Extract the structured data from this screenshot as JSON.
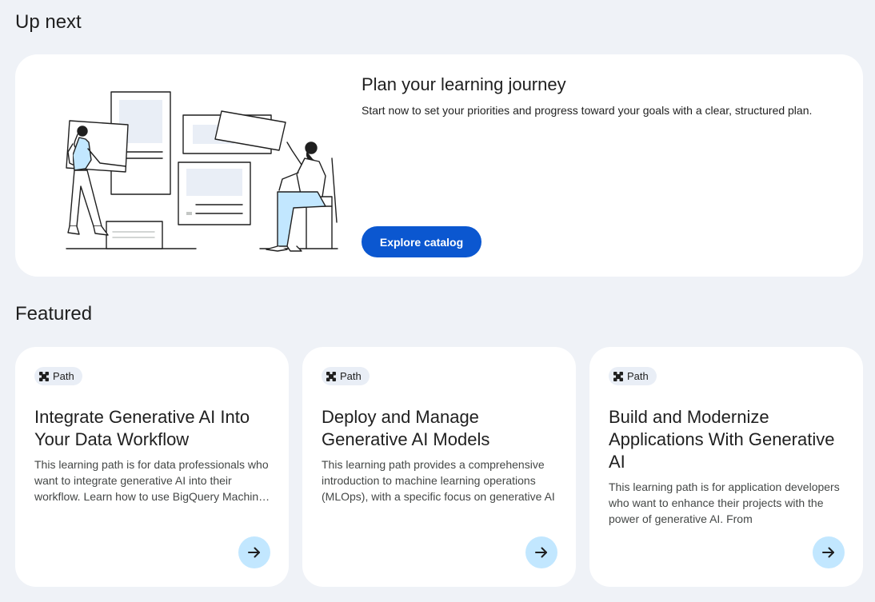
{
  "up_next": {
    "section_title": "Up next",
    "hero": {
      "title": "Plan your learning journey",
      "description": "Start now to set your priorities and progress toward your goals with a clear, structured plan.",
      "button_label": "Explore catalog"
    }
  },
  "featured": {
    "section_title": "Featured",
    "cards": [
      {
        "chip_label": "Path",
        "title": "Integrate Generative AI Into Your Data Workflow",
        "description": "This learning path is for data professionals who want to integrate generative AI into their workflow. Learn how to use BigQuery Machine Learning"
      },
      {
        "chip_label": "Path",
        "title": "Deploy and Manage Generative AI Models",
        "description": "This learning path provides a comprehensive introduction to machine learning operations (MLOps), with a specific focus on generative AI"
      },
      {
        "chip_label": "Path",
        "title": "Build and Modernize Applications With Generative AI",
        "description": "This learning path is for application developers who want to enhance their projects with the power of generative AI. From"
      }
    ]
  },
  "colors": {
    "page_bg": "#eff2f7",
    "card_bg": "#ffffff",
    "primary": "#0b57d0",
    "arrow_button_bg": "#c2e7ff",
    "chip_bg": "#e9eef6"
  },
  "icons": {
    "chip": "path-icon",
    "card_action": "arrow-right-icon"
  }
}
